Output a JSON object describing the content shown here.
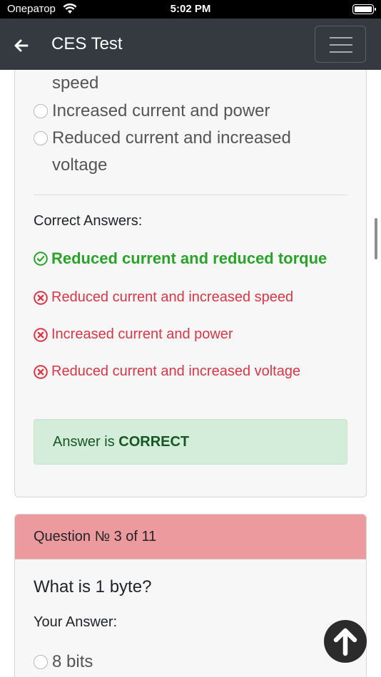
{
  "status_bar": {
    "carrier": "Оператор",
    "time": "5:02 PM"
  },
  "navbar": {
    "title": "CES Test"
  },
  "question2": {
    "options": [
      {
        "label": "speed"
      },
      {
        "label": "Increased current and power"
      },
      {
        "label": "Reduced current and increased voltage"
      }
    ],
    "correct_answers_label": "Correct Answers:",
    "answers": [
      {
        "label": "Reduced current and reduced torque",
        "status": "correct"
      },
      {
        "label": "Reduced current and increased speed",
        "status": "wrong"
      },
      {
        "label": "Increased current and power",
        "status": "wrong"
      },
      {
        "label": "Reduced current and increased voltage",
        "status": "wrong"
      }
    ],
    "result": {
      "prefix": "Answer is ",
      "verdict": "CORRECT"
    }
  },
  "question3": {
    "header": "Question № 3 of 11",
    "text": "What is 1 byte?",
    "your_answer_label": "Your Answer:",
    "options": [
      {
        "label": "8 bits"
      }
    ]
  },
  "colors": {
    "navbar": "#343a40",
    "correct": "#28a428",
    "wrong": "#dc3545",
    "alert_bg": "#d4edda",
    "question_header": "#ec9a9d"
  },
  "icons": [
    "wifi-icon",
    "battery-icon",
    "back-arrow-icon",
    "menu-icon",
    "check-circle-icon",
    "x-circle-icon",
    "arrow-up-icon"
  ]
}
